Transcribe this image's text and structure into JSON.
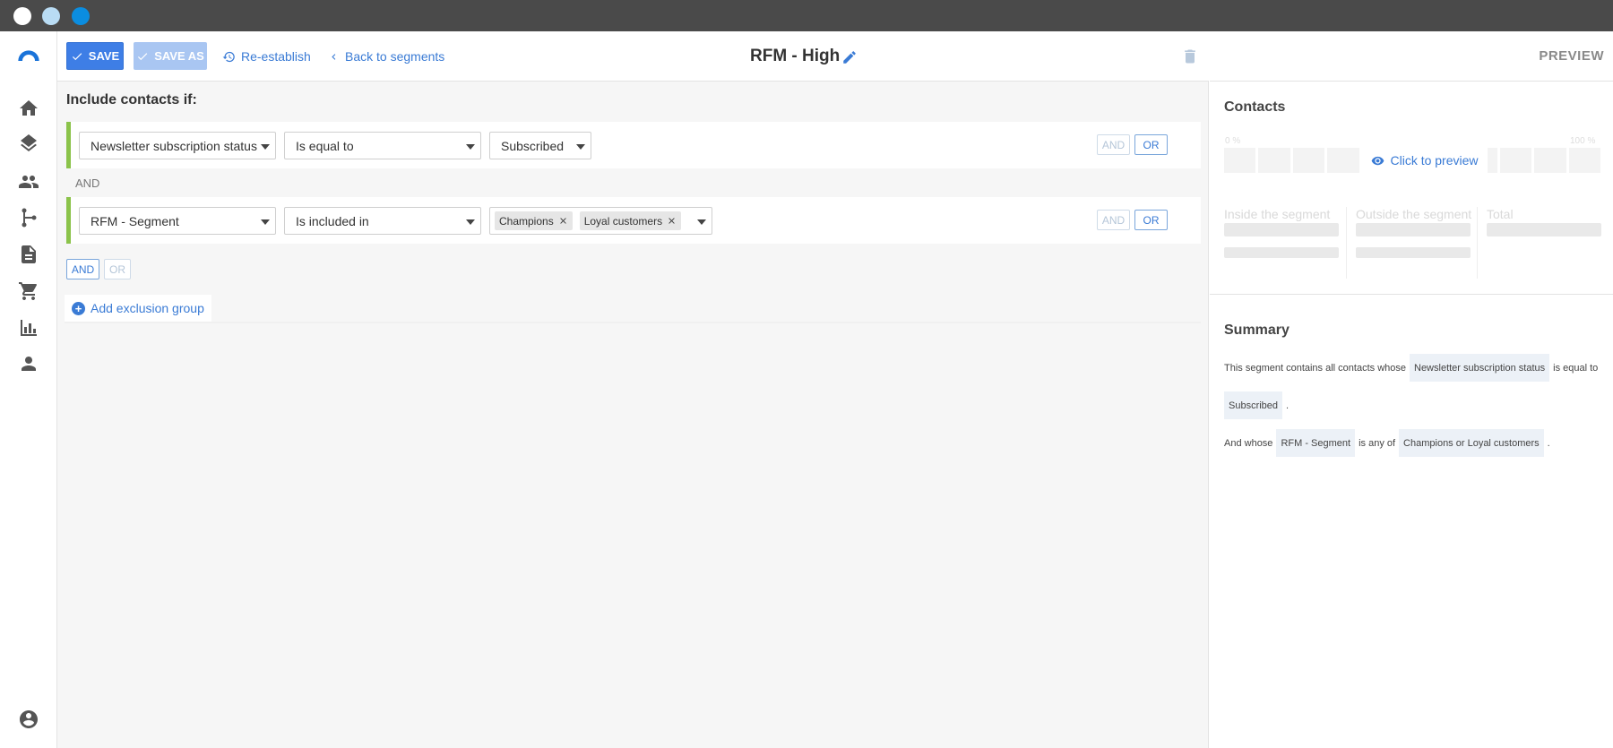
{
  "window": {
    "dots": [
      "#ffffff",
      "#b9dcf4",
      "#0b8de0"
    ]
  },
  "nav": {
    "items": [
      "logo-icon",
      "home-icon",
      "layers-icon",
      "people-icon",
      "workflow-icon",
      "document-icon",
      "cart-icon",
      "chart-icon",
      "person-icon",
      "account-icon"
    ]
  },
  "toolbar": {
    "save_label": "SAVE",
    "save_as_label": "SAVE AS",
    "reestablish_label": "Re-establish",
    "back_label": "Back to segments",
    "title": "RFM - High"
  },
  "rules": {
    "heading": "Include contacts if:",
    "rows": [
      {
        "field": "Newsletter subscription status",
        "operator": "Is equal to",
        "value": "Subscribed"
      },
      {
        "field": "RFM - Segment",
        "operator": "Is included in",
        "chips": [
          "Champions",
          "Loyal customers"
        ]
      }
    ],
    "separator": "AND",
    "and_label": "AND",
    "or_label": "OR",
    "add_exclusion_label": "Add exclusion group"
  },
  "preview": {
    "header": "PREVIEW",
    "contacts_title": "Contacts",
    "pct_min": "0 %",
    "pct_max": "100 %",
    "click_label": "Click to preview",
    "inside_label": "Inside the segment",
    "outside_label": "Outside the segment",
    "total_label": "Total"
  },
  "summary": {
    "title": "Summary",
    "line1_prefix": "This segment contains all contacts whose",
    "line1_field": "Newsletter subscription status",
    "line1_op": "is equal to",
    "line2_value": "Subscribed",
    "line2_end": ".",
    "line3_prefix": "And whose",
    "line3_field": "RFM - Segment",
    "line3_op": "is any of",
    "line3_value": "Champions or Loyal customers",
    "line3_end": "."
  },
  "colors": {
    "accent": "#3e7ee6",
    "rule_bar": "#8bc34a",
    "link": "#3a7bd5"
  }
}
